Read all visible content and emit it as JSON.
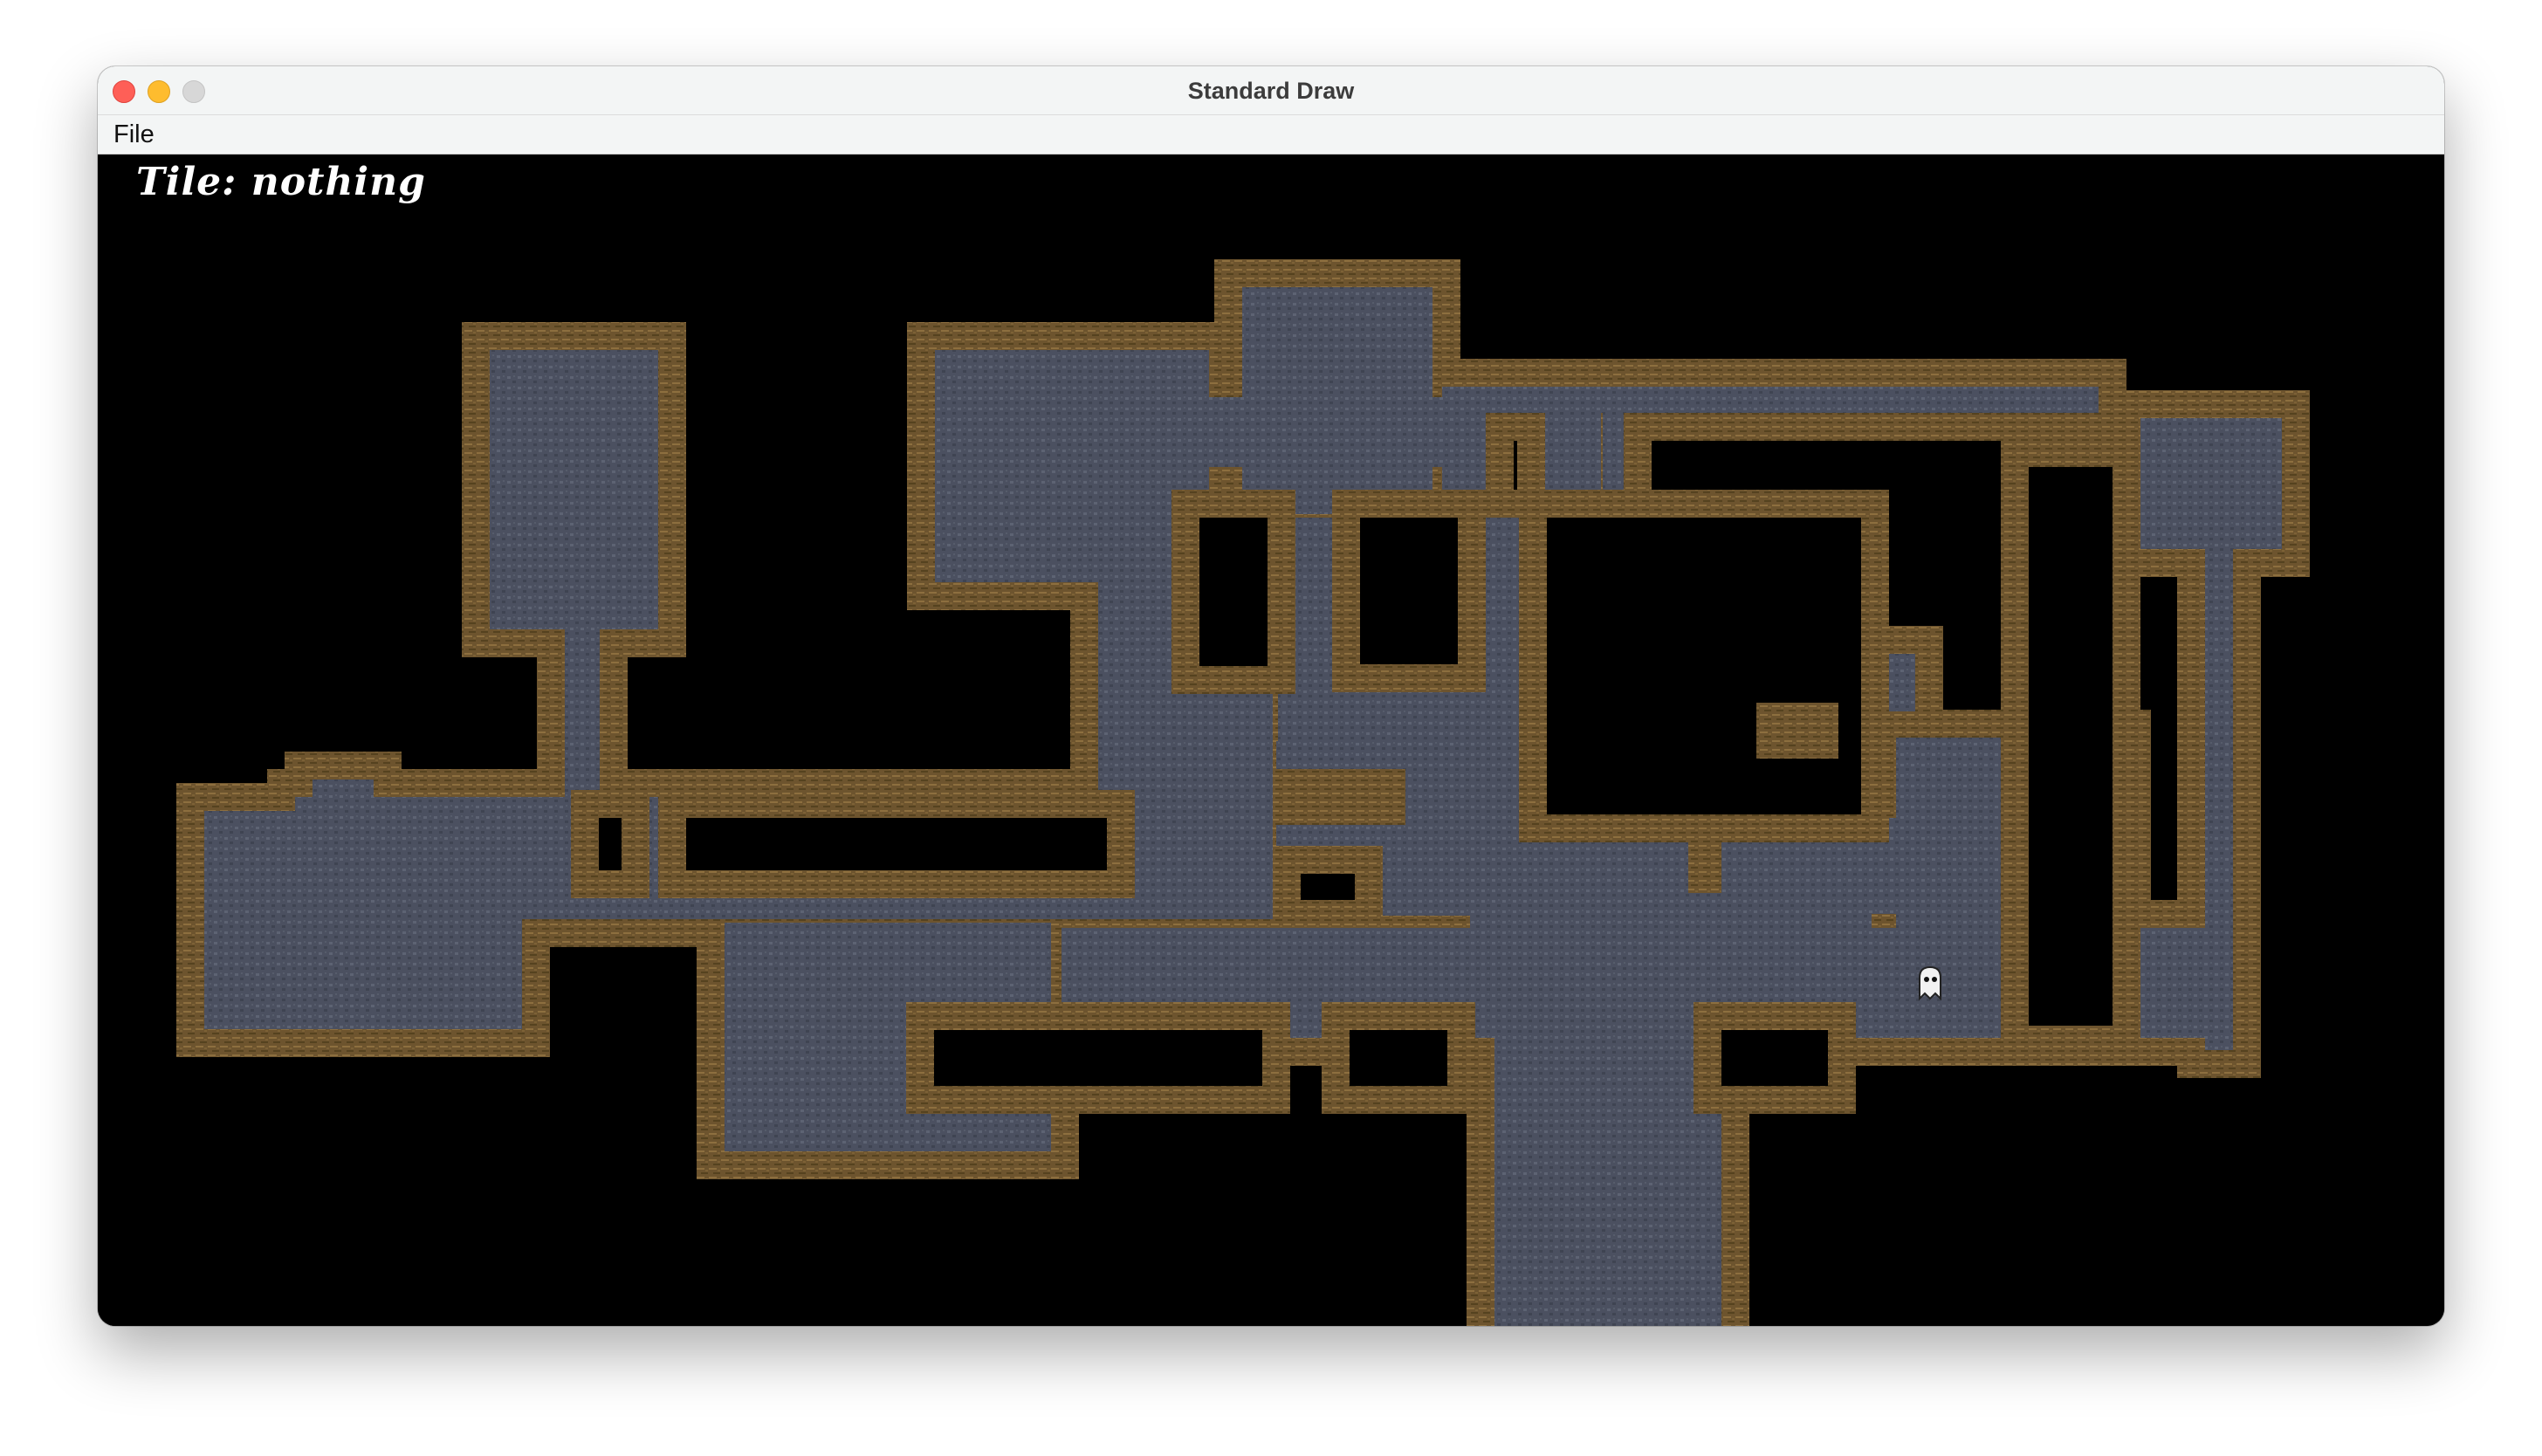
{
  "window": {
    "title": "Standard Draw"
  },
  "menu": {
    "file": "File"
  },
  "hud": {
    "tile_label": "Tile: nothing"
  },
  "colors": {
    "floor": "#4b5060",
    "floor_speck": "#5c6272",
    "wall": "#6f5630",
    "wall_light": "#8e7040",
    "void": "#000000"
  }
}
